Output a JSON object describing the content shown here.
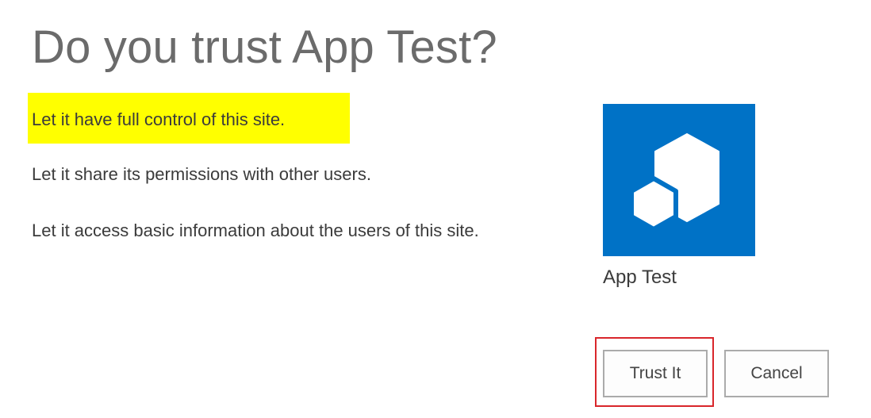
{
  "dialog": {
    "title": "Do you trust App Test?",
    "permissions": [
      "Let it have full control of this site.",
      "Let it share its permissions with other users.",
      "Let it access basic information about the users of this site."
    ],
    "highlighted_permission_color": "#ffff00"
  },
  "app": {
    "name": "App Test",
    "tile_color": "#0072c6",
    "icon": "app-hexagon-icon"
  },
  "actions": {
    "trust_label": "Trust It",
    "cancel_label": "Cancel",
    "focus_outline_color": "#d9262b"
  }
}
